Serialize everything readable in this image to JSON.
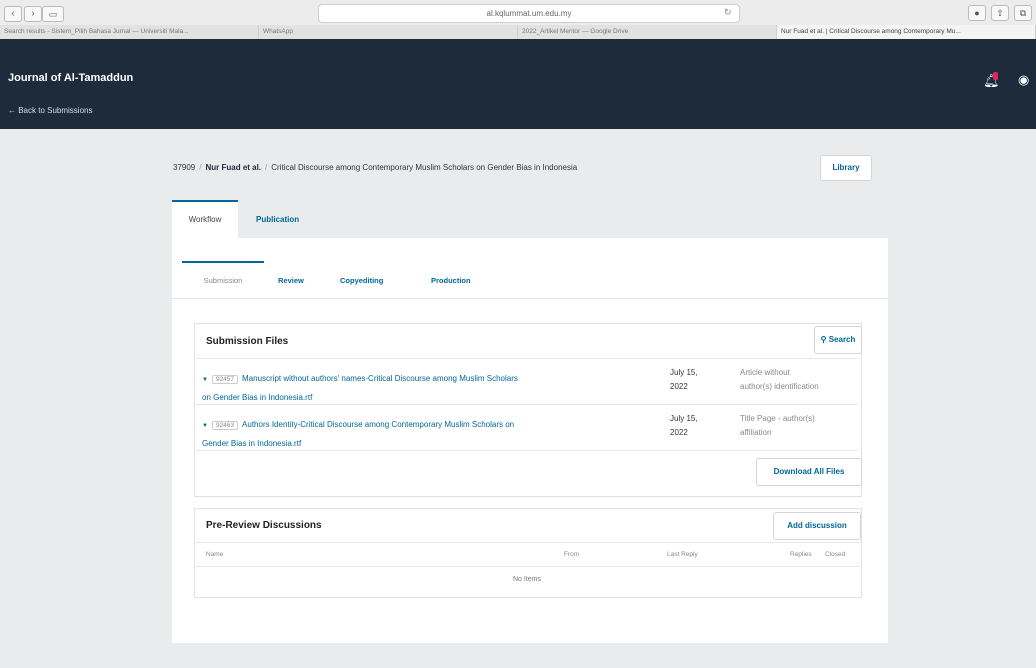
{
  "browser": {
    "url": "al.kqlummat.um.edu.my",
    "tabs": [
      "Search results - Sistem_Pilih Bahasa Jurnal — Universiti Mala...",
      "WhatsApp",
      "2022_Artikel Mentor — Google Drive",
      "Nur Fuad et al. | Critical Discourse among Contemporary Mu..."
    ]
  },
  "header": {
    "journal_title": "Journal of Al-Tamaddun",
    "back_link": "← Back to Submissions",
    "notification_count": "!"
  },
  "breadcrumb": {
    "id": "37909",
    "author": "Nur Fuad et al.",
    "title": "Critical Discourse among Contemporary Muslim Scholars on Gender Bias in Indonesia",
    "library_label": "Library"
  },
  "main_tabs": {
    "workflow": "Workflow",
    "publication": "Publication"
  },
  "sub_tabs": {
    "submission": "Submission",
    "review": "Review",
    "copyediting": "Copyediting",
    "production": "Production"
  },
  "files": {
    "title": "Submission Files",
    "search_label": "Search",
    "rows": [
      {
        "id": "92457",
        "name_line1": "Manuscript without authors' names-Critical Discourse among Muslim Scholars",
        "name_line2": "on Gender Bias in Indonesia.rtf",
        "date_line1": "July 15,",
        "date_line2": "2022",
        "type_line1": "Article without",
        "type_line2": "author(s) identification"
      },
      {
        "id": "92463",
        "name_line1": "Authors Identity-Critical Discourse among Contemporary Muslim Scholars on",
        "name_line2": "Gender Bias in Indonesia.rtf",
        "date_line1": "July 15,",
        "date_line2": "2022",
        "type_line1": "Title Page - author(s)",
        "type_line2": "affiliation"
      }
    ],
    "download_all": "Download All Files"
  },
  "discussions": {
    "title": "Pre-Review Discussions",
    "add_label": "Add discussion",
    "columns": {
      "name": "Name",
      "from": "From",
      "last_reply": "Last Reply",
      "replies": "Replies",
      "closed": "Closed"
    },
    "empty": "No Items"
  }
}
